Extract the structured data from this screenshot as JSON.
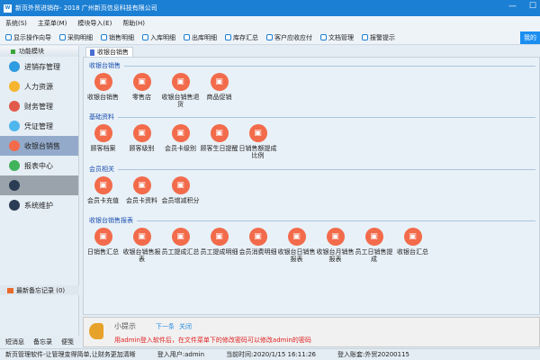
{
  "title": "新页外贸进销存- 2018 广州新页信息科技有限公司",
  "menu": [
    "系统(S)",
    "主菜单(M)",
    "模块导入(E)",
    "帮助(H)"
  ],
  "toolbar": [
    "显示操作向导",
    "采购明细",
    "销售明细",
    "入库明细",
    "出库明细",
    "库存汇总",
    "客户应收应付",
    "文档管理",
    "报警提示"
  ],
  "toolbar_right": "我的",
  "sidebar": {
    "header": "功能模块",
    "items": [
      "进销存管理",
      "人力资源",
      "财务管理",
      "凭证管理",
      "收银台销售",
      "报表中心",
      "",
      "系统维护"
    ],
    "memo": "最新备忘记录 (0)",
    "tabs": [
      "短消息",
      "备忘录",
      "便笺"
    ]
  },
  "tab": "收银台销售",
  "sections": [
    {
      "title": "收银台销售",
      "items": [
        "收银台销售",
        "零售店",
        "收银台销售退货",
        "商品促销"
      ]
    },
    {
      "title": "基础资料",
      "items": [
        "顾客档案",
        "顾客级别",
        "会员卡级别",
        "顾客生日提醒",
        "日销售额提成比例"
      ]
    },
    {
      "title": "会员相关",
      "items": [
        "会员卡充值",
        "会员卡资料",
        "会员增减积分"
      ]
    },
    {
      "title": "收银台销售报表",
      "items": [
        "日销售汇总",
        "收银台销售报表",
        "员工提成汇总",
        "员工提成明细",
        "会员消费明细",
        "收银台日销售报表",
        "收银台月销售报表",
        "员工日销售提成",
        "收银台汇总"
      ]
    }
  ],
  "tip": {
    "title": "小提示",
    "next": "下一条",
    "close": "关闭",
    "message": "用admin登入软件后，在文件菜单下的修改密码可以修改admin的密码"
  },
  "status": [
    "新页管理软件-让管理变得简单,让财务更加清晰",
    "登入用户:admin",
    "当前时间:2020/1/15 16:11:26",
    "登入账套:外贸20200115"
  ]
}
